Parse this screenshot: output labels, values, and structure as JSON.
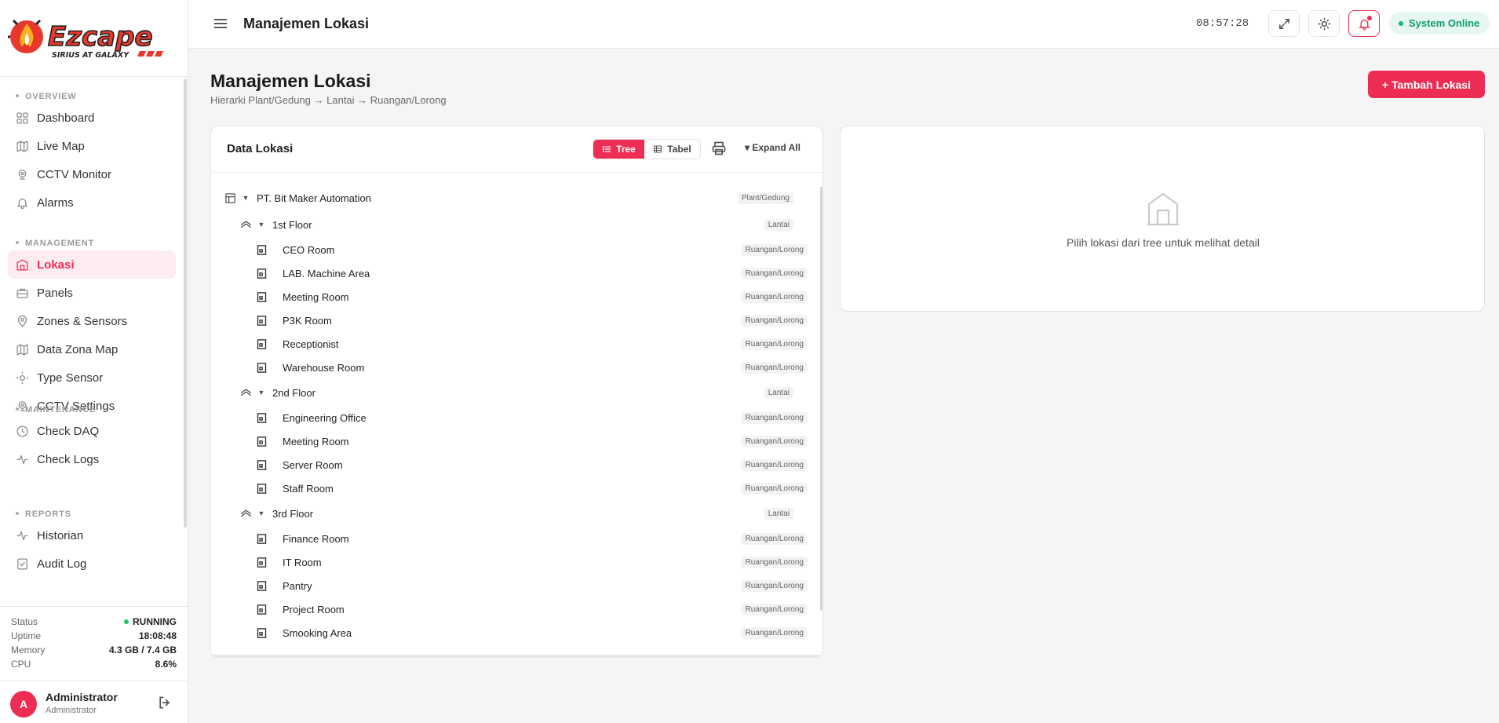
{
  "brand": {
    "name": "Ezcape",
    "tagline": "SIRIUS AT GALAXY"
  },
  "topbar": {
    "title": "Manajemen Lokasi",
    "time": "08:57:28",
    "status": "System Online"
  },
  "sidebar": {
    "sections": [
      {
        "title": "OVERVIEW",
        "items": [
          {
            "label": "Dashboard",
            "icon": "grid-icon"
          },
          {
            "label": "Live Map",
            "icon": "map-icon"
          },
          {
            "label": "CCTV Monitor",
            "icon": "camera-icon"
          },
          {
            "label": "Alarms",
            "icon": "bell-icon"
          }
        ]
      },
      {
        "title": "MANAGEMENT",
        "items": [
          {
            "label": "Lokasi",
            "icon": "building-icon",
            "active": true
          },
          {
            "label": "Panels",
            "icon": "briefcase-icon"
          },
          {
            "label": "Zones & Sensors",
            "icon": "pin-icon"
          },
          {
            "label": "Data Zona Map",
            "icon": "map-icon"
          },
          {
            "label": "Type Sensor",
            "icon": "sun-icon"
          },
          {
            "label": "CCTV Settings",
            "icon": "camera-icon"
          }
        ]
      },
      {
        "title": "MAINTENANCE",
        "items": [
          {
            "label": "Check DAQ",
            "icon": "clock-icon"
          },
          {
            "label": "Check Logs",
            "icon": "activity-icon"
          }
        ]
      },
      {
        "title": "REPORTS",
        "items": [
          {
            "label": "Historian",
            "icon": "activity-icon"
          },
          {
            "label": "Audit Log",
            "icon": "checklist-icon"
          }
        ]
      }
    ],
    "system": {
      "status_label": "Status",
      "status_value": "RUNNING",
      "uptime_label": "Uptime",
      "uptime_value": "18:08:48",
      "memory_label": "Memory",
      "memory_value": "4.3 GB / 7.4 GB",
      "cpu_label": "CPU",
      "cpu_value": "8.6%"
    },
    "user": {
      "initial": "A",
      "name": "Administrator",
      "role": "Administrator"
    }
  },
  "page": {
    "title": "Manajemen Lokasi",
    "breadcrumb": "Hierarki Plant/Gedung → Lantai → Ruangan/Lorong",
    "add_button": "+ Tambah Lokasi"
  },
  "data_panel": {
    "title": "Data Lokasi",
    "tree_label": "Tree",
    "table_label": "Tabel",
    "expand_label": "▾ Expand All",
    "nodes": [
      {
        "level": 0,
        "label": "PT. Bit Maker Automation",
        "type": "Plant/Gedung"
      },
      {
        "level": 1,
        "label": "1st Floor",
        "type": "Lantai"
      },
      {
        "level": 2,
        "label": "CEO Room",
        "type": "Ruangan/Lorong"
      },
      {
        "level": 2,
        "label": "LAB. Machine Area",
        "type": "Ruangan/Lorong"
      },
      {
        "level": 2,
        "label": "Meeting Room",
        "type": "Ruangan/Lorong"
      },
      {
        "level": 2,
        "label": "P3K Room",
        "type": "Ruangan/Lorong"
      },
      {
        "level": 2,
        "label": "Receptionist",
        "type": "Ruangan/Lorong"
      },
      {
        "level": 2,
        "label": "Warehouse Room",
        "type": "Ruangan/Lorong"
      },
      {
        "level": 1,
        "label": "2nd Floor",
        "type": "Lantai"
      },
      {
        "level": 2,
        "label": "Engineering Office",
        "type": "Ruangan/Lorong"
      },
      {
        "level": 2,
        "label": "Meeting Room",
        "type": "Ruangan/Lorong"
      },
      {
        "level": 2,
        "label": "Server Room",
        "type": "Ruangan/Lorong"
      },
      {
        "level": 2,
        "label": "Staff Room",
        "type": "Ruangan/Lorong"
      },
      {
        "level": 1,
        "label": "3rd Floor",
        "type": "Lantai"
      },
      {
        "level": 2,
        "label": "Finance Room",
        "type": "Ruangan/Lorong"
      },
      {
        "level": 2,
        "label": "IT Room",
        "type": "Ruangan/Lorong"
      },
      {
        "level": 2,
        "label": "Pantry",
        "type": "Ruangan/Lorong"
      },
      {
        "level": 2,
        "label": "Project Room",
        "type": "Ruangan/Lorong"
      },
      {
        "level": 2,
        "label": "Smooking Area",
        "type": "Ruangan/Lorong"
      }
    ]
  },
  "detail_panel": {
    "empty_text": "Pilih lokasi dari tree untuk melihat detail"
  },
  "colors": {
    "accent": "#ee2d55",
    "online": "#10b981"
  }
}
